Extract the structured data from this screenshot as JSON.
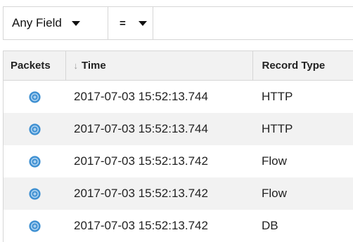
{
  "filter": {
    "field_label": "Any Field",
    "operator_label": "=",
    "value": ""
  },
  "table": {
    "columns": [
      {
        "label": "Packets"
      },
      {
        "label": "Time",
        "sort_indicator": "↓"
      },
      {
        "label": "Record Type"
      }
    ],
    "rows": [
      {
        "icon": "packet-capture-icon",
        "time": "2017-07-03 15:52:13.744",
        "record_type": "HTTP"
      },
      {
        "icon": "packet-capture-icon",
        "time": "2017-07-03 15:52:13.744",
        "record_type": "HTTP"
      },
      {
        "icon": "packet-capture-icon",
        "time": "2017-07-03 15:52:13.742",
        "record_type": "Flow"
      },
      {
        "icon": "packet-capture-icon",
        "time": "2017-07-03 15:52:13.742",
        "record_type": "Flow"
      },
      {
        "icon": "packet-capture-icon",
        "time": "2017-07-03 15:52:13.742",
        "record_type": "DB"
      }
    ]
  },
  "colors": {
    "icon_blue": "#3d8fd1",
    "icon_light": "#a9d0f0",
    "row_alt_bg": "#f2f2f2",
    "border": "#d6d6d6"
  }
}
